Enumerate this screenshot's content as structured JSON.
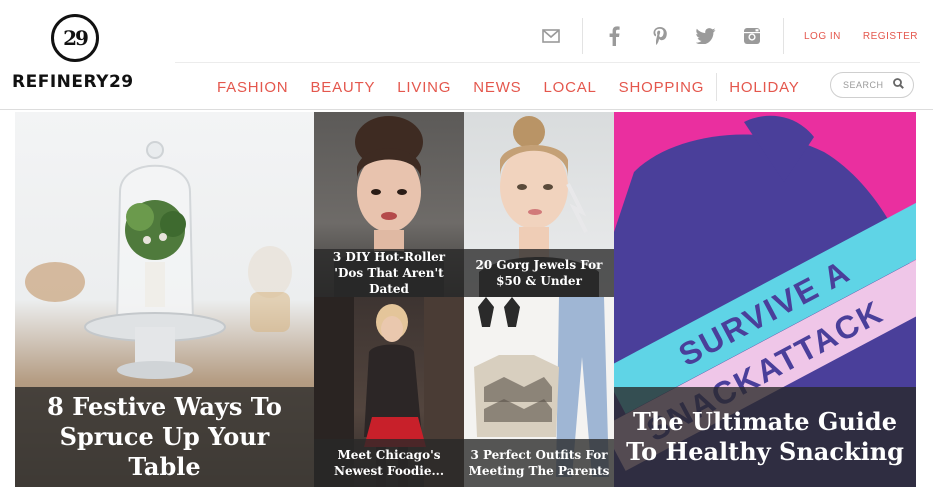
{
  "brand": {
    "logo_mark": "29",
    "name": "REFINERY29"
  },
  "utility": {
    "icons": [
      "mail-icon",
      "facebook-icon",
      "pinterest-icon",
      "twitter-icon",
      "instagram-icon"
    ],
    "login": "LOG IN",
    "register": "REGISTER"
  },
  "nav": {
    "items": [
      {
        "label": "FASHION"
      },
      {
        "label": "BEAUTY"
      },
      {
        "label": "LIVING"
      },
      {
        "label": "NEWS"
      },
      {
        "label": "LOCAL"
      },
      {
        "label": "SHOPPING"
      },
      {
        "label": "HOLIDAY"
      }
    ]
  },
  "search": {
    "placeholder": "SEARCH"
  },
  "tiles": [
    {
      "title": "8 Festive Ways To Spruce Up Your Table"
    },
    {
      "title": "3 DIY Hot-Roller 'Dos That Aren't Dated"
    },
    {
      "title": "20 Gorg Jewels For $50 & Under"
    },
    {
      "title": "Meet Chicago's Newest Foodie..."
    },
    {
      "title": "3 Perfect Outfits For Meeting The Parents"
    },
    {
      "title": "The Ultimate Guide To Healthy Snacking",
      "art_text_1": "SURVIVE A",
      "art_text_2": "SNACKATTACK"
    }
  ],
  "colors": {
    "accent": "#e4574d",
    "feature_pink": "#ea2f9f",
    "feature_cyan": "#5fd4e6",
    "feature_purple": "#4a3f9a"
  }
}
